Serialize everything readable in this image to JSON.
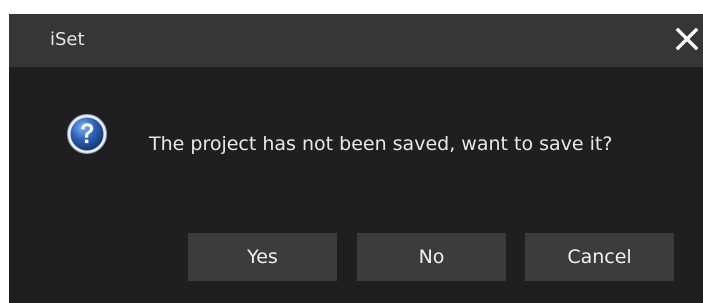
{
  "window": {
    "title": "iSet"
  },
  "dialog": {
    "icon": "question-icon",
    "message": "The project has not been saved, want to save it?"
  },
  "buttons": {
    "yes": "Yes",
    "no": "No",
    "cancel": "Cancel"
  },
  "colors": {
    "dialog_background": "#1f1f1f",
    "titlebar_background": "#363636",
    "button_background": "#3c3c3c",
    "icon_blue": "#2b5fb3",
    "text": "#e8e8e8"
  }
}
